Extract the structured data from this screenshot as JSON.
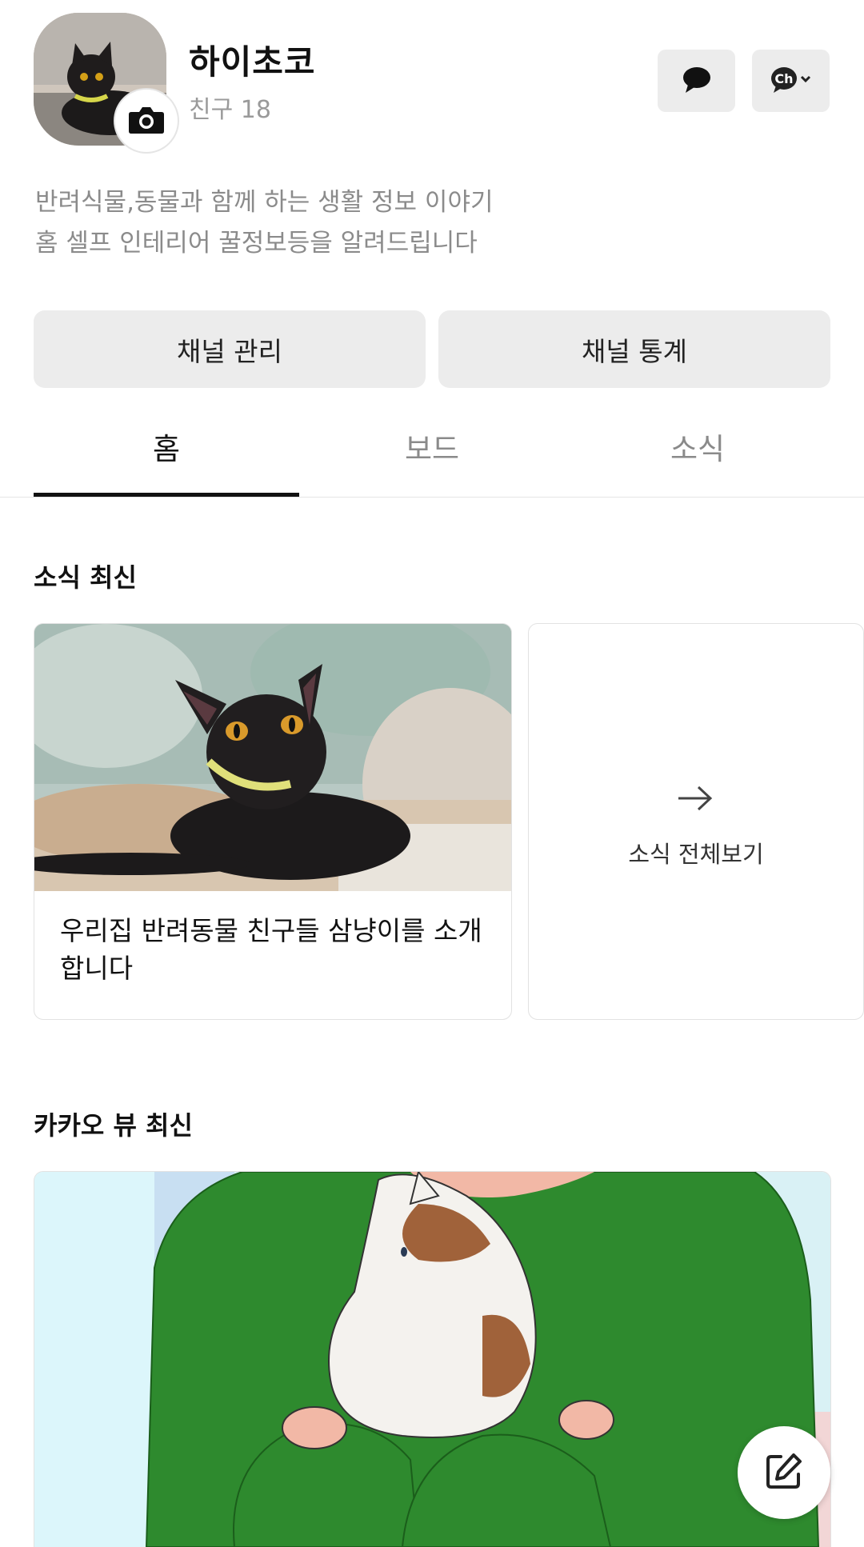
{
  "channel": {
    "name": "하이초코",
    "friends": "친구 18",
    "description_line1": "반려식물,동물과 함께 하는 생활 정보 이야기",
    "description_line2": "홈 셀프 인테리어 꿀정보등을 알려드립니다"
  },
  "header_buttons": {
    "chat_icon": "speech-bubble-icon",
    "channel_icon": "ch-dropdown-icon"
  },
  "actions": {
    "manage": "채널 관리",
    "stats": "채널 통계"
  },
  "tabs": [
    {
      "label": "홈",
      "active": true
    },
    {
      "label": "보드",
      "active": false
    },
    {
      "label": "소식",
      "active": false
    }
  ],
  "news": {
    "section_title": "소식 최신",
    "card_text": "우리집 반려동물 친구들 삼냥이를 소개합니다",
    "view_all": "소식 전체보기"
  },
  "kakao_view": {
    "section_title": "카카오 뷰 최신"
  },
  "colors": {
    "button_bg": "#ececec",
    "tab_active": "#111111",
    "sweater_green": "#2e8a2e"
  }
}
